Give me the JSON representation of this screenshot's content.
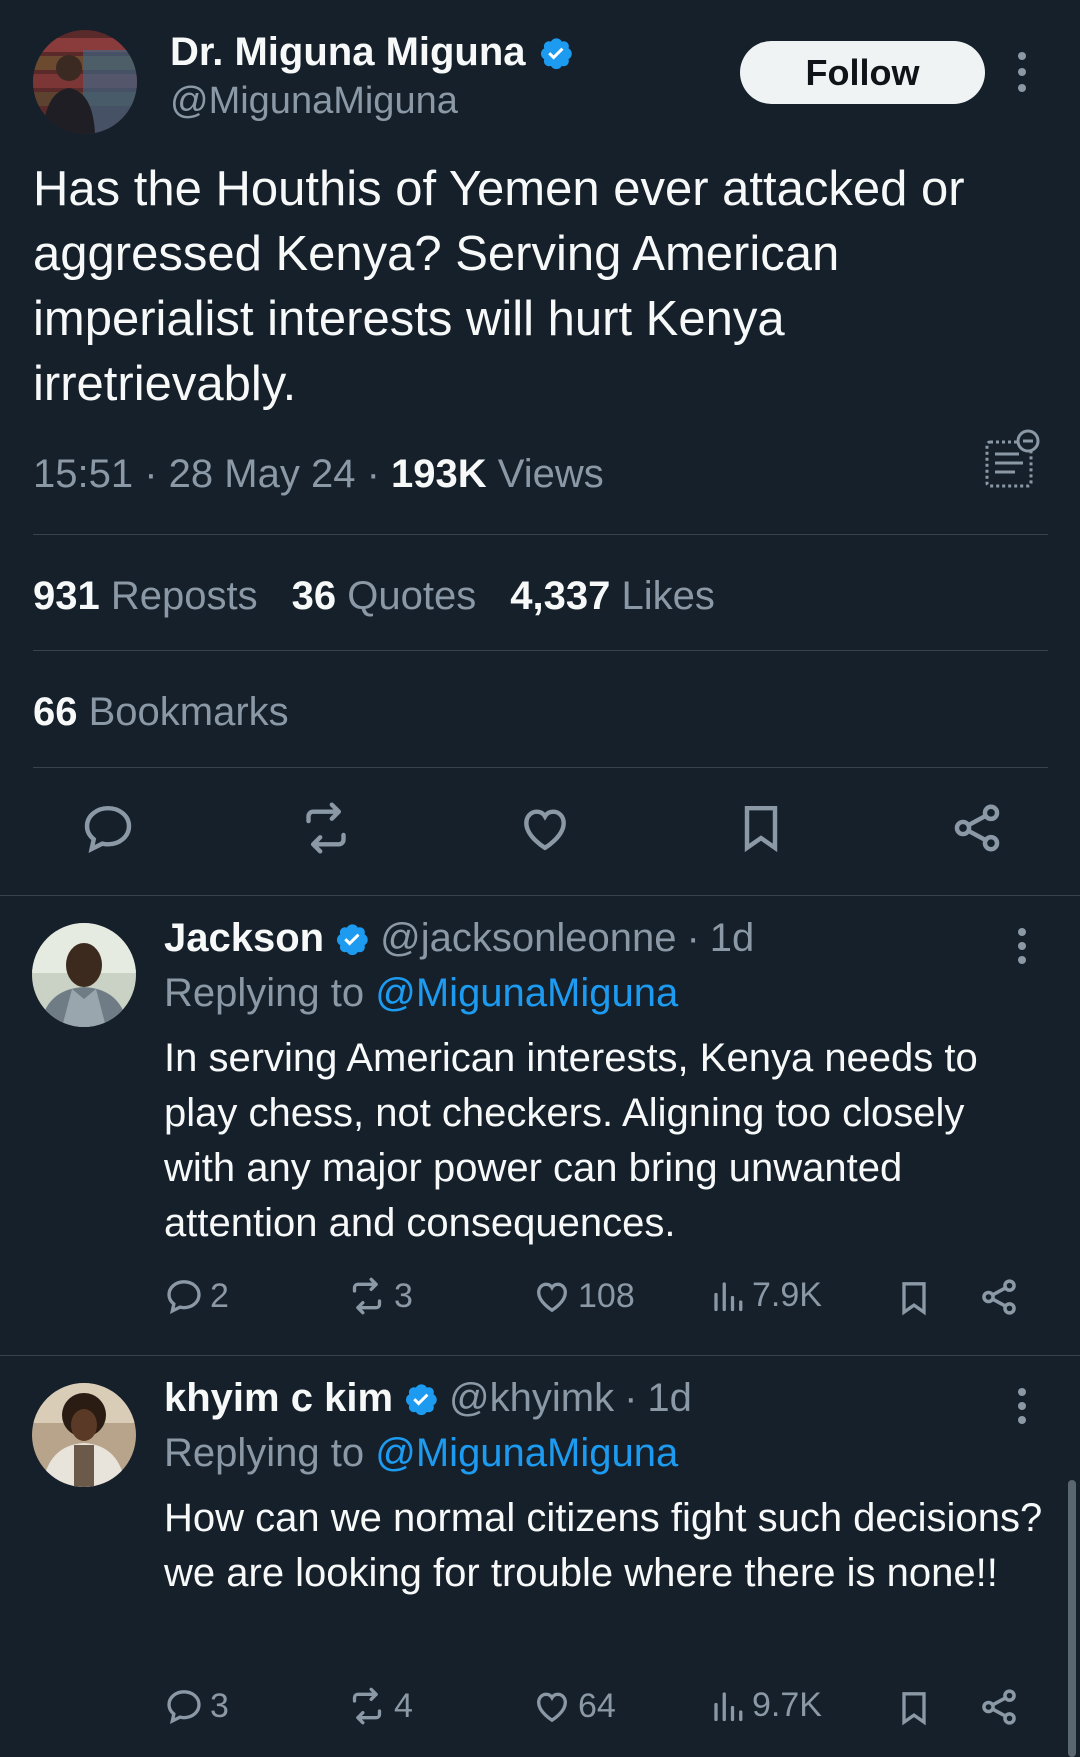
{
  "main_tweet": {
    "author_name": "Dr. Miguna Miguna",
    "author_handle": "@MigunaMiguna",
    "follow_label": "Follow",
    "text": "Has the Houthis of Yemen ever attacked or aggressed Kenya? Serving American imperialist interests will hurt Kenya irretrievably.",
    "time": "15:51",
    "date": "28 May 24",
    "views_count": "193K",
    "views_label": "Views",
    "reposts_count": "931",
    "reposts_label": "Reposts",
    "quotes_count": "36",
    "quotes_label": "Quotes",
    "likes_count": "4,337",
    "likes_label": "Likes",
    "bookmarks_count": "66",
    "bookmarks_label": "Bookmarks"
  },
  "replies": [
    {
      "name": "Jackson",
      "handle": "@jacksonleonne",
      "age": "1d",
      "replying_prefix": "Replying to",
      "replying_handle": "@MigunaMiguna",
      "text": "In serving American interests, Kenya needs to play chess, not checkers. Aligning too closely with any major power can bring unwanted attention and consequences.",
      "replies": "2",
      "reposts": "3",
      "likes": "108",
      "views": "7.9K"
    },
    {
      "name": "khyim c kim",
      "handle": "@khyimk",
      "age": "1d",
      "replying_prefix": "Replying to",
      "replying_handle": "@MigunaMiguna",
      "text": "How can we normal citizens fight such decisions?we are looking for trouble where there is none!!",
      "replies": "3",
      "reposts": "4",
      "likes": "64",
      "views": "9.7K"
    }
  ],
  "icons": {
    "verified": "verified-badge-icon",
    "more": "more-vertical-icon",
    "grok": "grok-summary-icon",
    "reply": "reply-icon",
    "repost": "repost-icon",
    "like": "heart-icon",
    "bookmark": "bookmark-icon",
    "share": "share-icon",
    "views": "views-icon"
  },
  "colors": {
    "background": "#15202b",
    "accent": "#1d9bf0",
    "muted_text": "#8b98a5",
    "divider": "#38444d"
  }
}
